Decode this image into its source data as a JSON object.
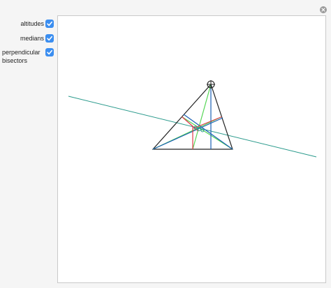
{
  "controls": [
    {
      "label": "altitudes",
      "checked": true
    },
    {
      "label": "medians",
      "checked": true
    },
    {
      "label": "perpendicular bisectors",
      "checked": true
    }
  ],
  "colors": {
    "checkbox": "#3b8ef0",
    "triangle": "#222222",
    "euler_line": "#2a9a8c",
    "altitudes": "#1a5fb4",
    "medians": "#55d655",
    "perpendicular_bisectors": "#e03a4a",
    "centers": "#2a9a8c"
  },
  "icons": {
    "check": "checkmark-icon",
    "close": "close-icon",
    "locator": "crosshair-locator-icon"
  }
}
